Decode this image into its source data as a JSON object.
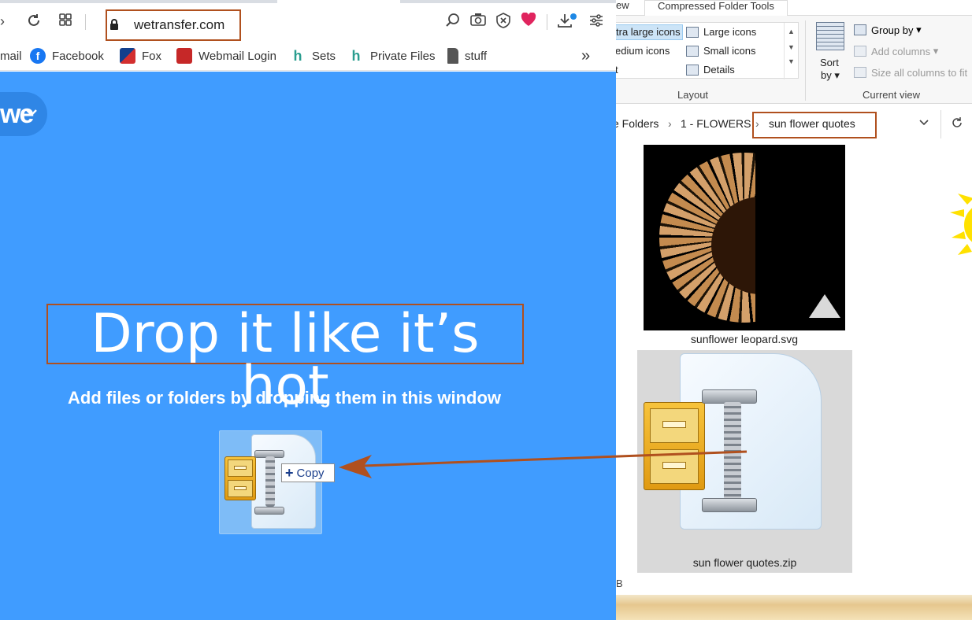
{
  "browser": {
    "url": "wetransfer.com",
    "bookmarks": [
      "mail",
      "Facebook",
      "Fox",
      "Webmail Login",
      "Sets",
      "Private Files",
      "stuff"
    ],
    "bookmark_overflow": "»"
  },
  "wetransfer": {
    "logo": "we",
    "headline": "Drop it like it’s hot",
    "subline": "Add files or folders by dropping them in this window",
    "drag_tooltip": "Copy",
    "drag_tooltip_plus": "+"
  },
  "explorer": {
    "ribbon_tabs": [
      "ew",
      "Compressed Folder Tools"
    ],
    "layout_options": [
      "tra large icons",
      "Large icons",
      "edium icons",
      "Small icons",
      "t",
      "Details"
    ],
    "layout_label": "Layout",
    "sort_label_1": "Sort",
    "sort_label_2": "by",
    "current_view": {
      "group_by": "Group by",
      "add_columns": "Add columns",
      "size_all": "Size all columns to fit",
      "label": "Current view"
    },
    "breadcrumbs": [
      "e Folders",
      "1 - FLOWERS",
      "sun flower quotes"
    ],
    "crumb_sep": "›",
    "files": [
      {
        "name": "sunflower leopard.svg"
      },
      {
        "name": "sun flower quotes.zip"
      }
    ],
    "status_text": "B"
  },
  "colors": {
    "wetransfer_blue": "#409cff",
    "annotation": "#b0501e",
    "selection": "#cce4f7"
  }
}
